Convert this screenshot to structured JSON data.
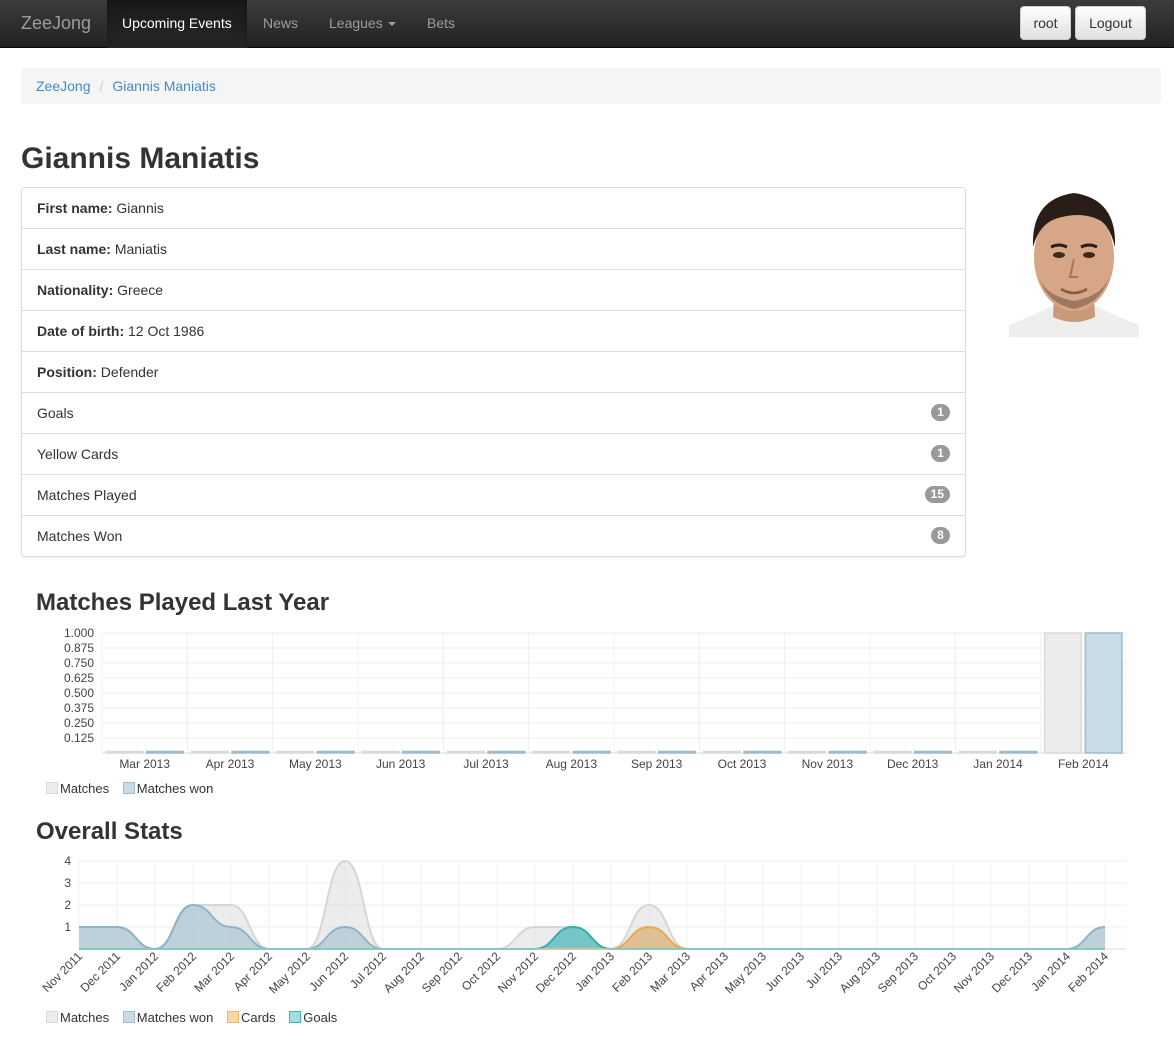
{
  "navbar": {
    "brand": "ZeeJong",
    "items": [
      "Upcoming Events",
      "News",
      "Leagues",
      "Bets"
    ],
    "user_button": "root",
    "logout_button": "Logout"
  },
  "breadcrumb": [
    "ZeeJong",
    "Giannis Maniatis"
  ],
  "player": {
    "name": "Giannis Maniatis",
    "first_name_label": "First name",
    "first_name": "Giannis",
    "last_name_label": "Last name",
    "last_name": "Maniatis",
    "nationality_label": "Nationality",
    "nationality": "Greece",
    "dob_label": "Date of birth",
    "dob": "12 Oct 1986",
    "position_label": "Position",
    "position": "Defender",
    "stats": [
      {
        "label": "Goals",
        "value": "1"
      },
      {
        "label": "Yellow Cards",
        "value": "1"
      },
      {
        "label": "Matches Played",
        "value": "15"
      },
      {
        "label": "Matches Won",
        "value": "8"
      }
    ]
  },
  "colors": {
    "matches": "#e5e5e5",
    "matches_won": "#aec9d8",
    "cards": "#f5c98a",
    "goals": "#6fcfcc"
  },
  "chart_data": [
    {
      "type": "bar",
      "title": "Matches Played Last Year",
      "categories": [
        "Mar 2013",
        "Apr 2013",
        "May 2013",
        "Jun 2013",
        "Jul 2013",
        "Aug 2013",
        "Sep 2013",
        "Oct 2013",
        "Nov 2013",
        "Dec 2013",
        "Jan 2014",
        "Feb 2014"
      ],
      "yticks": [
        "0.125",
        "0.250",
        "0.375",
        "0.500",
        "0.625",
        "0.750",
        "0.875",
        "1.000"
      ],
      "ylim": [
        0,
        1
      ],
      "series": [
        {
          "name": "Matches",
          "values": [
            0,
            0,
            0,
            0,
            0,
            0,
            0,
            0,
            0,
            0,
            0,
            1
          ]
        },
        {
          "name": "Matches won",
          "values": [
            0,
            0,
            0,
            0,
            0,
            0,
            0,
            0,
            0,
            0,
            0,
            1
          ]
        }
      ],
      "legend": "bottom-left",
      "grid": true
    },
    {
      "type": "area",
      "title": "Overall Stats",
      "categories": [
        "Nov 2011",
        "Dec 2011",
        "Jan 2012",
        "Feb 2012",
        "Mar 2012",
        "Apr 2012",
        "May 2012",
        "Jun 2012",
        "Jul 2012",
        "Aug 2012",
        "Sep 2012",
        "Oct 2012",
        "Nov 2012",
        "Dec 2012",
        "Jan 2013",
        "Feb 2013",
        "Mar 2013",
        "Apr 2013",
        "May 2013",
        "Jun 2013",
        "Jul 2013",
        "Aug 2013",
        "Sep 2013",
        "Oct 2013",
        "Nov 2013",
        "Dec 2013",
        "Jan 2014",
        "Feb 2014"
      ],
      "yticks": [
        "1",
        "2",
        "3",
        "4"
      ],
      "ylim": [
        0,
        4
      ],
      "series": [
        {
          "name": "Matches",
          "values": [
            1,
            1,
            0,
            2,
            2,
            0,
            0,
            4,
            0,
            0,
            0,
            0,
            1,
            1,
            0,
            2,
            0,
            0,
            0,
            0,
            0,
            0,
            0,
            0,
            0,
            0,
            0,
            1
          ]
        },
        {
          "name": "Matches won",
          "values": [
            1,
            1,
            0,
            2,
            1,
            0,
            0,
            1,
            0,
            0,
            0,
            0,
            0,
            1,
            0,
            1,
            0,
            0,
            0,
            0,
            0,
            0,
            0,
            0,
            0,
            0,
            0,
            1
          ]
        },
        {
          "name": "Cards",
          "values": [
            0,
            0,
            0,
            0,
            0,
            0,
            0,
            0,
            0,
            0,
            0,
            0,
            0,
            0,
            0,
            1,
            0,
            0,
            0,
            0,
            0,
            0,
            0,
            0,
            0,
            0,
            0,
            0
          ]
        },
        {
          "name": "Goals",
          "values": [
            0,
            0,
            0,
            0,
            0,
            0,
            0,
            0,
            0,
            0,
            0,
            0,
            0,
            1,
            0,
            0,
            0,
            0,
            0,
            0,
            0,
            0,
            0,
            0,
            0,
            0,
            0,
            0
          ]
        }
      ],
      "legend": "bottom-left",
      "grid": true
    }
  ]
}
